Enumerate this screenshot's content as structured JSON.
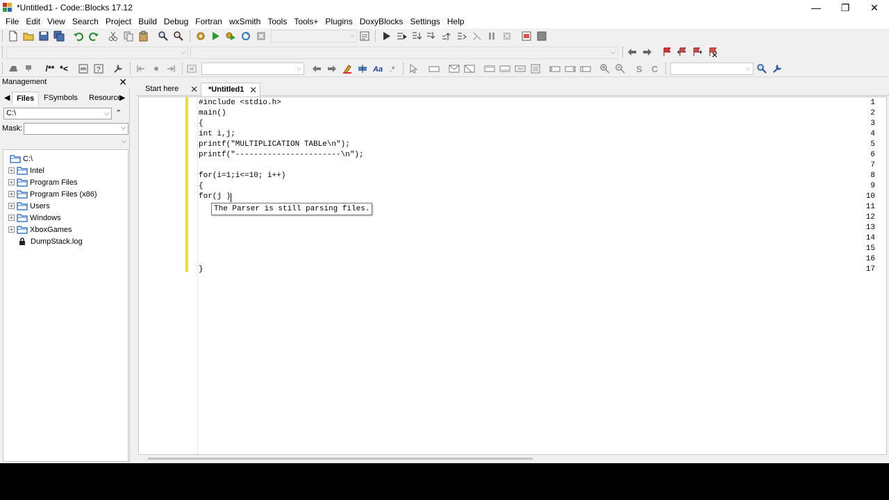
{
  "window": {
    "title": "*Untitled1 - Code::Blocks 17.12",
    "controls": {
      "minimize": "—",
      "maximize": "❐",
      "close": "✕"
    }
  },
  "menu": [
    "File",
    "Edit",
    "View",
    "Search",
    "Project",
    "Build",
    "Debug",
    "Fortran",
    "wxSmith",
    "Tools",
    "Tools+",
    "Plugins",
    "DoxyBlocks",
    "Settings",
    "Help"
  ],
  "toolbar": {
    "comment_label": "/**",
    "comment2_label": "*<"
  },
  "management": {
    "title": "Management",
    "tabs": [
      "Files",
      "FSymbols",
      "Resource"
    ],
    "active_tab": "Files",
    "path": "C:\\",
    "mask_label": "Mask:",
    "mask_value": "",
    "tree": {
      "root": "C:\\",
      "items": [
        {
          "label": "Intel",
          "type": "folder"
        },
        {
          "label": "Program Files",
          "type": "folder"
        },
        {
          "label": "Program Files (x86)",
          "type": "folder"
        },
        {
          "label": "Users",
          "type": "folder"
        },
        {
          "label": "Windows",
          "type": "folder"
        },
        {
          "label": "XboxGames",
          "type": "folder"
        },
        {
          "label": "DumpStack.log",
          "type": "locked-file"
        }
      ]
    }
  },
  "editor": {
    "tabs": [
      {
        "label": "Start here",
        "active": false
      },
      {
        "label": "*Untitled1",
        "active": true
      }
    ],
    "lines": [
      "#include <stdio.h>",
      "main()",
      "{",
      "int i,j;",
      "printf(\"MULTIPLICATION TABLe\\n\");",
      "printf(\"-----------------------\\n\");",
      "",
      "for(i=1;i<=10; i++)",
      "{",
      "for(j )",
      "",
      "",
      "",
      "",
      "",
      "",
      "}"
    ],
    "line_numbers": [
      "1",
      "2",
      "3",
      "4",
      "5",
      "6",
      "7",
      "8",
      "9",
      "10",
      "11",
      "12",
      "13",
      "14",
      "15",
      "16",
      "17"
    ],
    "tooltip": "The Parser is still parsing files."
  },
  "colors": {
    "change_bar": "#f0dc3c",
    "folder": "#3a78c8",
    "background": "#f0f0f0"
  }
}
